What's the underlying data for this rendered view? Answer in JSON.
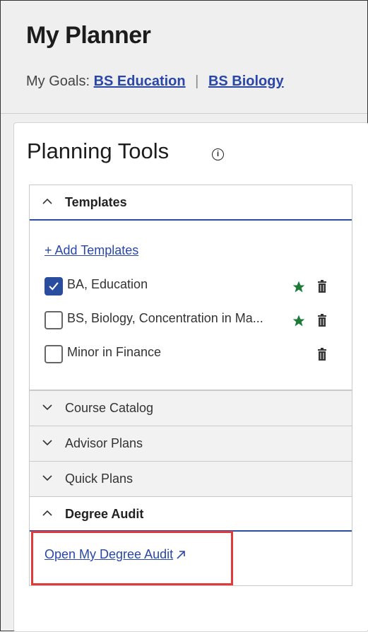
{
  "header": {
    "title": "My Planner",
    "goals_prefix": "My Goals:",
    "goals": [
      "BS Education",
      "BS Biology"
    ],
    "separator": "|"
  },
  "panel": {
    "title": "Planning Tools",
    "info_icon": "info-icon"
  },
  "accordion": {
    "templates": {
      "label": "Templates",
      "state": "expanded",
      "add_link": "+ Add Templates",
      "items": [
        {
          "label": "BA, Education",
          "checked": true,
          "starred": true,
          "icon_star": "star-icon",
          "icon_delete": "trash-icon"
        },
        {
          "label": "BS, Biology, Concentration in Ma...",
          "checked": false,
          "starred": true,
          "icon_star": "star-icon",
          "icon_delete": "trash-icon"
        },
        {
          "label": "Minor in Finance",
          "checked": false,
          "starred": false,
          "icon_delete": "trash-icon"
        }
      ]
    },
    "course_catalog": {
      "label": "Course Catalog",
      "state": "collapsed"
    },
    "advisor_plans": {
      "label": "Advisor Plans",
      "state": "collapsed"
    },
    "quick_plans": {
      "label": "Quick Plans",
      "state": "collapsed"
    },
    "degree_audit": {
      "label": "Degree Audit",
      "state": "expanded",
      "link": "Open My Degree Audit",
      "link_icon": "external-link-icon"
    }
  },
  "colors": {
    "accent": "#2a4c9e",
    "link": "#2a47a8",
    "star": "#1f7a3a",
    "highlight": "#e13a3a"
  }
}
